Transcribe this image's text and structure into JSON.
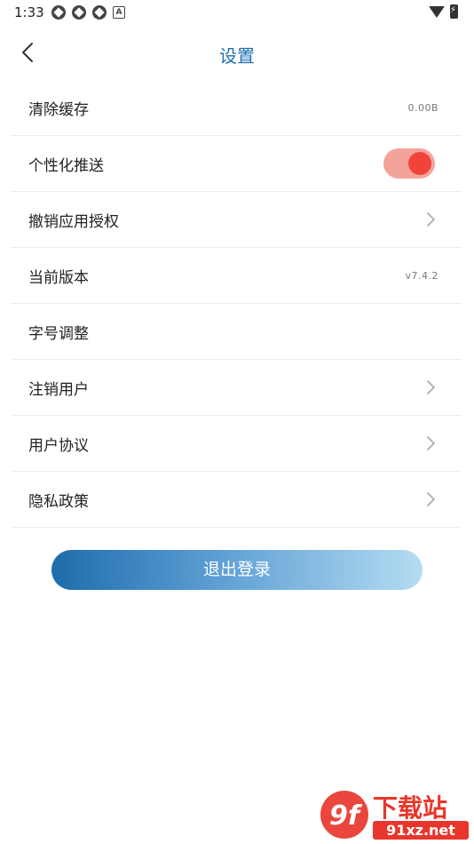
{
  "status_bar": {
    "time": "1:33",
    "left_icons": [
      "app-icon",
      "app-icon",
      "app-icon",
      "a-icon"
    ],
    "a_glyph": "A",
    "right_icons": [
      "wifi-icon",
      "battery-icon"
    ]
  },
  "header": {
    "title": "设置",
    "back_icon": "chevron-left-icon"
  },
  "settings": {
    "items": [
      {
        "label": "清除缓存",
        "value": "0.00B"
      },
      {
        "label": "个性化推送",
        "toggle_on": true
      },
      {
        "label": "撤销应用授权",
        "chevron": true
      },
      {
        "label": "当前版本",
        "value": "v7.4.2"
      },
      {
        "label": "字号调整"
      },
      {
        "label": "注销用户",
        "chevron": true
      },
      {
        "label": "用户协议",
        "chevron": true
      },
      {
        "label": "隐私政策",
        "chevron": true
      }
    ]
  },
  "logout": {
    "label": "退出登录"
  },
  "watermark": {
    "logo_text": "9f",
    "title": "下载站",
    "domain": "91xz.net"
  },
  "colors": {
    "title": "#1f6fb2",
    "toggle_track": "#f4a39b",
    "toggle_knob": "#f0443a",
    "logout_gradient_start": "#1f6cab",
    "logout_gradient_end": "#b5dcf2",
    "watermark_red": "#e8362c"
  }
}
